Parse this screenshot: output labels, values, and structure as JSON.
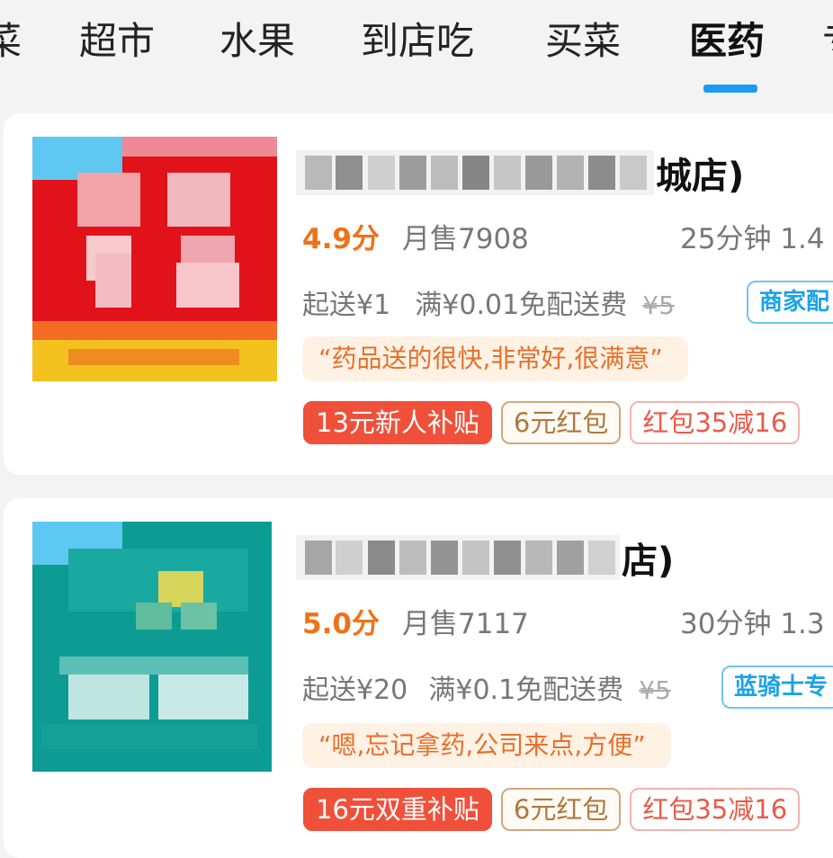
{
  "category_tabs": [
    {
      "label": "菜"
    },
    {
      "label": "超市"
    },
    {
      "label": "水果"
    },
    {
      "label": "到店吃"
    },
    {
      "label": "买菜"
    },
    {
      "label": "医药",
      "active": true
    },
    {
      "label": "专"
    }
  ],
  "accent_color": "#1e9bf0",
  "stores": [
    {
      "name_visible_suffix": "城店)",
      "rating": "4.9分",
      "monthly_sales": "月售7908",
      "delivery_info": "25分钟 1.4",
      "min_order": "起送¥1",
      "free_delivery": "满¥0.01免配送费",
      "original_fee": "¥5",
      "delivery_tag": "商家配",
      "review": "“药品送的很快,非常好,很满意”",
      "coupons": [
        "13元新人补贴",
        "6元红包",
        "红包35减16"
      ]
    },
    {
      "name_visible_suffix": "店)",
      "rating": "5.0分",
      "monthly_sales": "月售7117",
      "delivery_info": "30分钟 1.3",
      "min_order": "起送¥20",
      "free_delivery": "满¥0.1免配送费",
      "original_fee": "¥5",
      "delivery_tag": "蓝骑士专",
      "review": "“嗯,忘记拿药,公司来点,方便”",
      "coupons": [
        "16元双重补贴",
        "6元红包",
        "红包35减16"
      ]
    }
  ]
}
